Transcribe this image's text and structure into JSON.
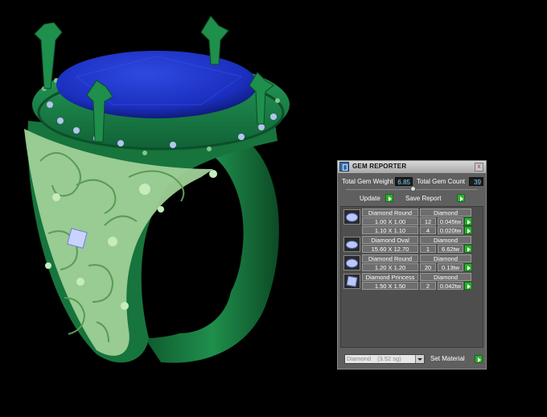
{
  "panel": {
    "title": "GEM REPORTER",
    "close_glyph": "x",
    "total_weight_label": "Total Gem Weight",
    "total_weight_value": "6.85",
    "total_count_label": "Total Gem Count",
    "total_count_value": "39",
    "update_label": "Update",
    "save_label": "Save Report",
    "material_value": "Diamond",
    "material_density": "(3.52 sg)",
    "set_material_label": "Set Material",
    "gems": [
      {
        "name": "Diamond Round",
        "material": "Diamond",
        "rows": [
          {
            "size": "1.00 X 1.00",
            "count": "12",
            "weight": "0.045tw"
          },
          {
            "size": "1.10 X 1.10",
            "count": "4",
            "weight": "0.020tw"
          }
        ]
      },
      {
        "name": "Diamond Oval",
        "material": "Diamond",
        "rows": [
          {
            "size": "15.60 X 12.70",
            "count": "1",
            "weight": "6.62tw"
          }
        ]
      },
      {
        "name": "Diamond Round",
        "material": "Diamond",
        "rows": [
          {
            "size": "1.20 X 1.20",
            "count": "20",
            "weight": "0.13tw"
          }
        ]
      },
      {
        "name": "Diamond Princess",
        "material": "Diamond",
        "rows": [
          {
            "size": "1.50 X 1.50",
            "count": "2",
            "weight": "0.042tw"
          }
        ]
      }
    ]
  },
  "colors": {
    "wax_green": "#1f8f4c",
    "filigree": "#a9d8a0",
    "gem_blue": "#1b2fbf",
    "go_button": "#2fae2f"
  }
}
